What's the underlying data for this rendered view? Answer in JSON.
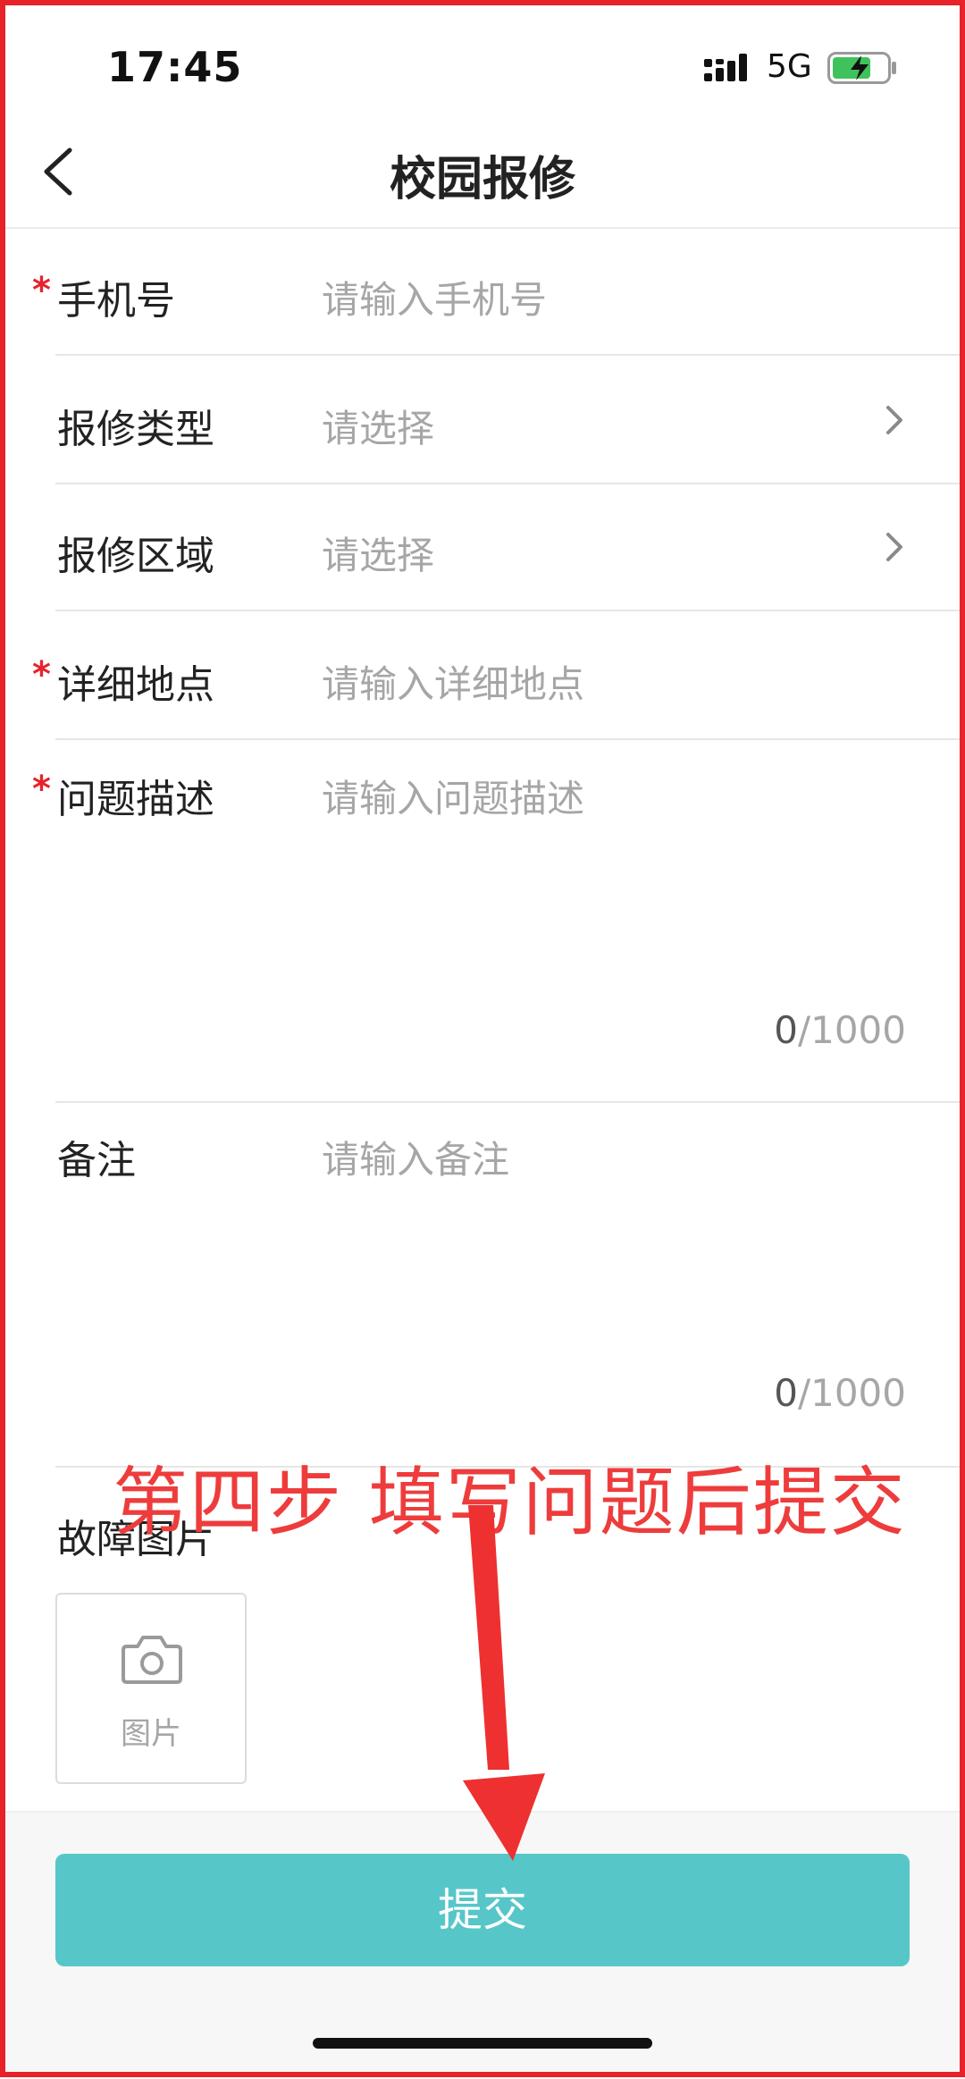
{
  "status_bar": {
    "time": "17:45",
    "network": "5G",
    "signal_icon": "signal-bars-icon",
    "battery_icon": "battery-charging-icon"
  },
  "nav": {
    "back_icon": "chevron-left-icon",
    "title": "校园报修"
  },
  "form": {
    "phone": {
      "required_mark": "*",
      "label": "手机号",
      "placeholder": "请输入手机号"
    },
    "repair_type": {
      "label": "报修类型",
      "placeholder": "请选择"
    },
    "repair_area": {
      "label": "报修区域",
      "placeholder": "请选择"
    },
    "location": {
      "required_mark": "*",
      "label": "详细地点",
      "placeholder": "请输入详细地点"
    },
    "description": {
      "required_mark": "*",
      "label": "问题描述",
      "placeholder": "请输入问题描述",
      "count_current": "0",
      "count_max": "/1000"
    },
    "remark": {
      "label": "备注",
      "placeholder": "请输入备注",
      "count_current": "0",
      "count_max": "/1000"
    },
    "photos": {
      "label": "故障图片",
      "upload_label": "图片",
      "upload_icon": "camera-icon"
    }
  },
  "submit_label": "提交",
  "annotation": {
    "text": "第四步 填写问题后提交",
    "color": "#ee3c3c"
  },
  "colors": {
    "accent": "#57c6c9",
    "required": "#e8222a",
    "placeholder": "#a6a6a6"
  }
}
